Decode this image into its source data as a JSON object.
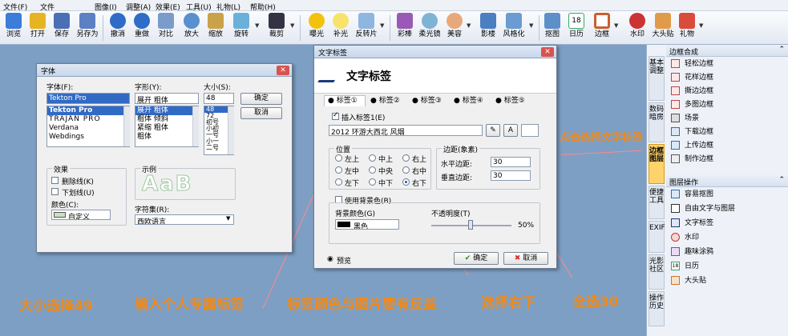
{
  "menubar": {
    "items": [
      "文件(F)",
      "文件",
      "图像(I)",
      "调整(A)",
      "效果(E)",
      "工具(U)",
      "礼物(L)",
      "帮助(H)"
    ]
  },
  "toolbar": {
    "buttons": [
      "浏览",
      "打开",
      "保存",
      "另存为",
      "撤消",
      "重做",
      "对比",
      "放大",
      "缩放",
      "旋转",
      "裁剪",
      "曝光",
      "补光",
      "反转片",
      "彩棒",
      "柔光镜",
      "美容",
      "影楼",
      "风格化",
      "抠图",
      "日历",
      "边框",
      "水印",
      "大头贴",
      "礼物"
    ],
    "calendar_day": "18"
  },
  "font_dialog": {
    "title": "字体",
    "font_label": "字体(F):",
    "font_value": "Tekton Pro",
    "fonts": [
      "Tekton Pro",
      "TRAJAN PRO",
      "Verdana",
      "Webdings"
    ],
    "style_label": "字形(Y):",
    "style_value": "展开 粗体",
    "styles": [
      "展开 粗体",
      "粗体 倾斜",
      "紧缩 粗体",
      "粗体"
    ],
    "size_label": "大小(S):",
    "size_value": "48",
    "sizes": [
      "48",
      "72",
      "初号",
      "小初",
      "一号",
      "小一",
      "二号"
    ],
    "ok": "确定",
    "cancel": "取消",
    "effects_label": "效果",
    "strike_label": "删除线(K)",
    "underline_label": "下划线(U)",
    "color_label": "颜色(C):",
    "color_value": "自定义",
    "sample_label": "示例",
    "sample_text": "AaB",
    "charset_label": "字符集(R):",
    "charset_value": "西欧语言"
  },
  "tag_dialog": {
    "title": "文字标签",
    "header": "文字标签",
    "tabs": [
      "标签①",
      "标签②",
      "标签③",
      "标签④",
      "标签⑤"
    ],
    "insert_label": "插入标签1(E)",
    "text_value": "2012 环游大西北  风烟",
    "position_label": "位置",
    "positions": [
      "左上",
      "中上",
      "右上",
      "左中",
      "中央",
      "右中",
      "左下",
      "中下",
      "右下"
    ],
    "margin_label": "边距(象素)",
    "h_margin_label": "水平边距:",
    "h_margin_value": "30",
    "v_margin_label": "垂直边距:",
    "v_margin_value": "30",
    "use_bg_label": "使用背景色(B)",
    "bg_color_label": "背景颜色(G)",
    "bg_color_value": "黑色",
    "opacity_label": "不透明度(T)",
    "opacity_value": "50%",
    "preview": "预览",
    "ok": "确定",
    "cancel": "取消"
  },
  "annotations": {
    "size": "大小选择49",
    "tag_text": "输入个人专属标签",
    "color": "标签颜色与图片要有反差",
    "corner": "选择右下",
    "all30": "全选30",
    "side": "点击选择文字标签"
  },
  "right_panel": {
    "vtabs": [
      "基本调整",
      "数码暗房",
      "边框图层",
      "便捷工具",
      "EXIF",
      "光影社区",
      "操作历史"
    ],
    "frame_header": "边框合成",
    "frame_items": [
      "轻松边框",
      "花样边框",
      "撕边边框",
      "多图边框",
      "场景",
      "下载边框",
      "上传边框",
      "制作边框"
    ],
    "layer_header": "图层操作",
    "layer_items": [
      "容易抠图",
      "自由文字与图层",
      "文字标签",
      "水印",
      "趣味涂鸦",
      "日历",
      "大头贴"
    ],
    "calendar_day": "18"
  },
  "colors": {
    "accent": "#f08a1a",
    "arrow": "#ff8a8a",
    "background": "#7e9fc4",
    "selection": "#316ac5"
  }
}
